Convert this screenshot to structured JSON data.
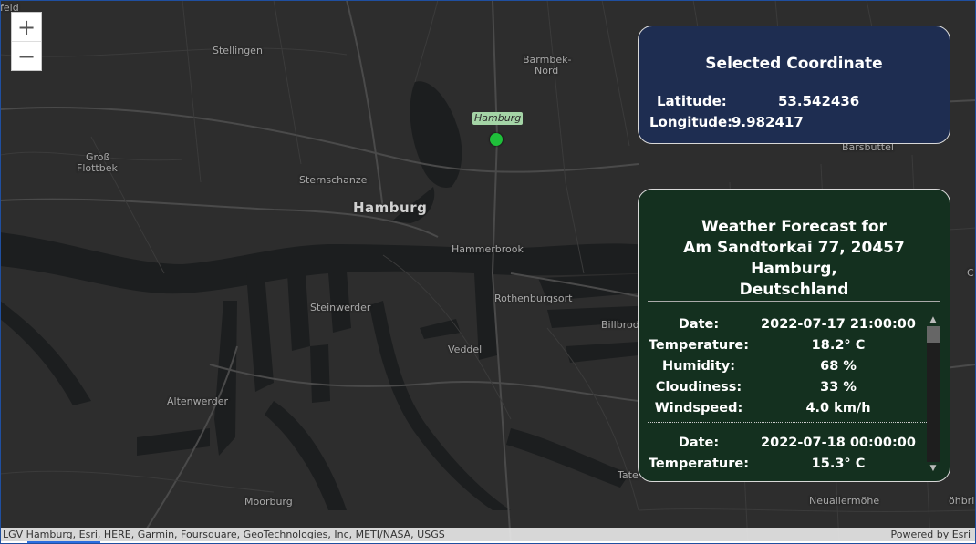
{
  "map": {
    "labels": {
      "feld": "feld",
      "stellingen": "Stellingen",
      "barmbek": "Barmbek-",
      "nord": "Nord",
      "gross": "Groß",
      "flottbek": "Flottbek",
      "sternschanze": "Sternschanze",
      "hamburg": "Hamburg",
      "hammerbrook": "Hammerbrook",
      "steinwerder": "Steinwerder",
      "rothenburgsort": "Rothenburgsort",
      "veddel": "Veddel",
      "altenwerder": "Altenwerder",
      "moorburg": "Moorburg",
      "barsbuettel": "Barsbüttel",
      "billbrook": "Billbrod",
      "tatenberg": "Tate",
      "neuallermoehe": "Neuallermöhe",
      "c_edge": "C",
      "ohb": "öhbri"
    },
    "pin_label": "Hamburg",
    "pin_color": "#1fbf3a",
    "zoom": {
      "in": "+",
      "out": "−"
    }
  },
  "coordinate_panel": {
    "title": "Selected Coordinate",
    "latitude_label": "Latitude:",
    "latitude": "53.542436",
    "longitude_label": "Longitude:",
    "longitude": "9.982417",
    "bg": "#1e2d51"
  },
  "weather_panel": {
    "title_line1": "Weather Forecast for",
    "title_line2": "Am Sandtorkai 77, 20457 Hamburg,",
    "title_line3": "Deutschland",
    "bg": "#14301f",
    "labels": {
      "date": "Date:",
      "temperature": "Temperature:",
      "humidity": "Humidity:",
      "cloudiness": "Cloudiness:",
      "windspeed": "Windspeed:"
    },
    "entries": [
      {
        "date": "2022-07-17 21:00:00",
        "temperature": "18.2° C",
        "humidity": "68 %",
        "cloudiness": "33 %",
        "windspeed": "4.0 km/h"
      },
      {
        "date": "2022-07-18 00:00:00",
        "temperature": "15.3° C"
      }
    ]
  },
  "attribution": {
    "left": "LGV Hamburg, Esri, HERE, Garmin, Foursquare, GeoTechnologies, Inc, METI/NASA, USGS",
    "right": "Powered by Esri"
  }
}
